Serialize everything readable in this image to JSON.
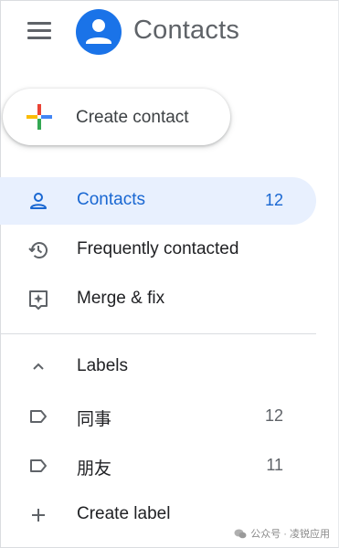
{
  "header": {
    "menu_icon": "hamburger-menu-icon",
    "avatar_icon": "person-icon",
    "title": "Contacts"
  },
  "create_contact": {
    "label": "Create contact",
    "icon": "multicolor-plus-icon",
    "colors": {
      "blue": "#4285F4",
      "red": "#EA4335",
      "yellow": "#FBBC04",
      "green": "#34A853"
    }
  },
  "nav": {
    "items": [
      {
        "label": "Contacts",
        "count": "12",
        "icon": "person-icon",
        "active": true
      },
      {
        "label": "Frequently contacted",
        "count": "",
        "icon": "history-icon",
        "active": false
      },
      {
        "label": "Merge & fix",
        "count": "",
        "icon": "merge-fix-icon",
        "active": false
      }
    ]
  },
  "labels": {
    "header": "Labels",
    "icon": "chevron-up-icon",
    "items": [
      {
        "label": "同事",
        "count": "12",
        "icon": "label-icon"
      },
      {
        "label": "朋友",
        "count": "11",
        "icon": "label-icon"
      }
    ],
    "create_label": "Create label",
    "create_icon": "plus-icon"
  },
  "watermark": {
    "text": "公众号 · 凌锐应用",
    "icon": "wechat-icon"
  },
  "colors": {
    "accent": "#1a73e8",
    "active_bg": "#e8f0fe",
    "active_text": "#1967d2",
    "icon_gray": "#5f6368"
  }
}
